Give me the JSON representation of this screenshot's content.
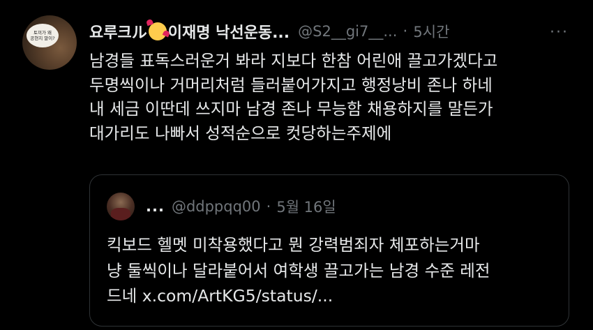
{
  "tweet": {
    "avatar_bubble_text": "토끼가 왜\n공현지 말이?",
    "display_name": "요루크ル",
    "display_name_suffix": "이재명 낙선운동...",
    "handle": "@S2__gi7__...",
    "separator": "·",
    "time": "5시간",
    "more_label": "···",
    "body_lines": [
      "남경들 표독스러운거 봐라 지보다 한참 어린애 끌고가겠다고",
      "두명씩이나 거머리처럼 들러붙어가지고 행정낭비 존나 하네",
      "내 세금 이딴데 쓰지마 남경 존나 무능함 채용하지를 말든가",
      "대가리도 나빠서 성적순으로 컷당하는주제에"
    ]
  },
  "quote": {
    "display_name": "...",
    "handle": "@ddppqq00",
    "separator": "·",
    "date": "5월 16일",
    "body_lines": [
      "킥보드 헬멧 미착용했다고 뭔 강력범죄자 체포하는거마",
      "냥 둘씩이나 달라붙어서 여학생 끌고가는 남경 수준 레전",
      "드네 x.com/ArtKG5/status/..."
    ]
  }
}
